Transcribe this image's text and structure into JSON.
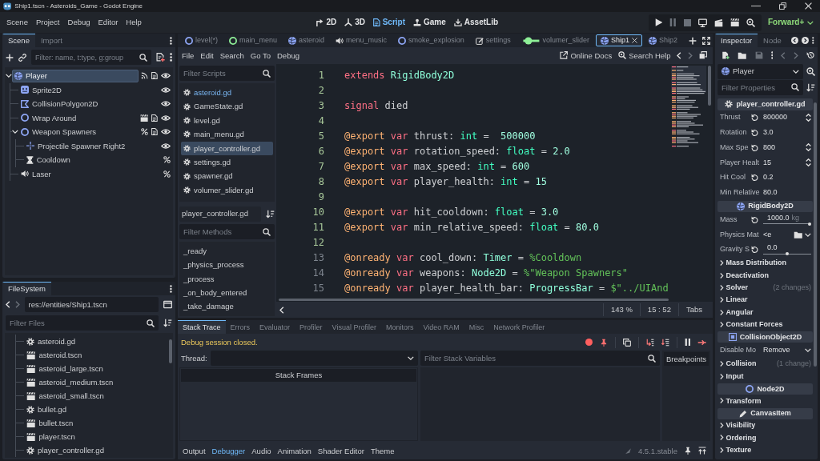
{
  "window": {
    "title": "Ship1.tscn - Asteroids_Game - Godot Engine"
  },
  "menu": [
    "Scene",
    "Project",
    "Debug",
    "Editor",
    "Help"
  ],
  "workspaces": [
    {
      "label": "2D",
      "kind": "canvas",
      "selected": false
    },
    {
      "label": "3D",
      "kind": "spatial",
      "selected": false
    },
    {
      "label": "Script",
      "kind": "script",
      "selected": true
    },
    {
      "label": "Game",
      "kind": "game",
      "selected": false
    },
    {
      "label": "AssetLib",
      "kind": "assetlib",
      "selected": false
    }
  ],
  "renderer": "Forward+",
  "scene_dock": {
    "tabs": [
      {
        "label": "Scene",
        "selected": true
      },
      {
        "label": "Import",
        "selected": false
      }
    ],
    "filter": {
      "placeholder": "Filter: name, t:type, g:group"
    },
    "tree": [
      {
        "name": "Player",
        "kind": "rigidbody",
        "selected": true,
        "expanded": true,
        "badges": [
          {
            "kind": "signal"
          },
          {
            "kind": "script"
          },
          {
            "kind": "eye"
          }
        ],
        "children": [
          {
            "name": "Sprite2D",
            "kind": "sprite",
            "selected": false,
            "badges": [
              {
                "kind": "eye"
              }
            ]
          },
          {
            "name": "CollisionPolygon2D",
            "kind": "polygon",
            "selected": false,
            "badges": [
              {
                "kind": "eye"
              }
            ]
          },
          {
            "name": "Wrap Around",
            "kind": "node2d",
            "selected": false,
            "badges": [
              {
                "kind": "scene"
              },
              {
                "kind": "script"
              },
              {
                "kind": "eye"
              }
            ]
          },
          {
            "name": "Weapon Spawners",
            "kind": "node2d",
            "selected": false,
            "expanded": true,
            "badges": [
              {
                "kind": "unique"
              },
              {
                "kind": "script"
              },
              {
                "kind": "eye"
              }
            ],
            "children": [
              {
                "name": "Projectile Spawner Right2",
                "kind": "marker",
                "selected": false,
                "badges": [
                  {
                    "kind": "eye"
                  }
                ]
              },
              {
                "name": "Cooldown",
                "kind": "timer",
                "selected": false,
                "badges": [
                  {
                    "kind": "unique"
                  }
                ]
              }
            ]
          },
          {
            "name": "Laser",
            "kind": "audio",
            "selected": false,
            "badges": [
              {
                "kind": "unique"
              }
            ]
          }
        ]
      }
    ]
  },
  "filesystem": {
    "tabs": [
      {
        "label": "FileSystem",
        "selected": true
      }
    ],
    "path": "res://entities/Ship1.tscn",
    "filter": {
      "placeholder": "Filter Files"
    },
    "files": [
      {
        "name": "asteroid.gd",
        "kind": "script"
      },
      {
        "name": "asteroid.tscn",
        "kind": "scene"
      },
      {
        "name": "asteroid_large.tscn",
        "kind": "scene"
      },
      {
        "name": "asteroid_medium.tscn",
        "kind": "scene"
      },
      {
        "name": "asteroid_small.tscn",
        "kind": "scene"
      },
      {
        "name": "bullet.gd",
        "kind": "script"
      },
      {
        "name": "bullet.tscn",
        "kind": "scene"
      },
      {
        "name": "player.tscn",
        "kind": "scene"
      },
      {
        "name": "player_controller.gd",
        "kind": "script"
      }
    ]
  },
  "script_tabs": [
    {
      "label": "level(*)",
      "kind": "node2d",
      "selected": false
    },
    {
      "label": "main_menu",
      "kind": "control",
      "selected": false
    },
    {
      "label": "asteroid",
      "kind": "rigidbody",
      "selected": false
    },
    {
      "label": "menu_music",
      "kind": "audio",
      "selected": false
    },
    {
      "label": "smoke_explosion",
      "kind": "node2d",
      "selected": false
    },
    {
      "label": "settings",
      "kind": "edit",
      "selected": false
    },
    {
      "label": "volumer_slider",
      "kind": "slider",
      "selected": false
    },
    {
      "label": "Ship1",
      "kind": "rigidbody",
      "selected": true
    },
    {
      "label": "Ship2",
      "kind": "rigidbody",
      "selected": false
    }
  ],
  "script_menu": [
    "File",
    "Edit",
    "Search",
    "Go To",
    "Debug"
  ],
  "help_links": [
    {
      "label": "Online Docs",
      "kind": "docs"
    },
    {
      "label": "Search Help",
      "kind": "search"
    }
  ],
  "script_list": {
    "filter": {
      "placeholder": "Filter Scripts"
    },
    "items": [
      {
        "name": "asteroid.gd",
        "selected": false,
        "highlighted": true
      },
      {
        "name": "GameState.gd",
        "selected": false,
        "highlighted": false
      },
      {
        "name": "level.gd",
        "selected": false,
        "highlighted": false
      },
      {
        "name": "main_menu.gd",
        "selected": false,
        "highlighted": false
      },
      {
        "name": "player_controller.gd",
        "selected": true,
        "highlighted": false
      },
      {
        "name": "settings.gd",
        "selected": false,
        "highlighted": false
      },
      {
        "name": "spawner.gd",
        "selected": false,
        "highlighted": false
      },
      {
        "name": "volumer_slider.gd",
        "selected": false,
        "highlighted": false
      }
    ],
    "current": "player_controller.gd",
    "method_filter": {
      "placeholder": "Filter Methods"
    },
    "methods": [
      "_ready",
      "_physics_process",
      "_process",
      "_on_body_entered",
      "_take_damage"
    ]
  },
  "code": {
    "lines": [
      {
        "number": "1",
        "safe": true,
        "tokens": [
          {
            "kind": "keyword",
            "text": "extends"
          },
          {
            "kind": "enginetype",
            "text": " RigidBody2D"
          }
        ]
      },
      {
        "number": "2",
        "safe": true
      },
      {
        "number": "3",
        "safe": true,
        "tokens": [
          {
            "kind": "keyword",
            "text": "signal"
          },
          {
            "kind": "plain",
            "text": " died"
          }
        ]
      },
      {
        "number": "4",
        "safe": true
      },
      {
        "number": "5",
        "safe": true,
        "tokens": [
          {
            "kind": "annotation",
            "text": "@export"
          },
          {
            "kind": "keyword",
            "text": " var"
          },
          {
            "kind": "plain",
            "text": " thrust: "
          },
          {
            "kind": "basetype",
            "text": "int"
          },
          {
            "kind": "plain",
            "text": " =  "
          },
          {
            "kind": "number",
            "text": "500000"
          }
        ]
      },
      {
        "number": "6",
        "safe": true,
        "tokens": [
          {
            "kind": "annotation",
            "text": "@export"
          },
          {
            "kind": "keyword",
            "text": " var"
          },
          {
            "kind": "plain",
            "text": " rotation_speed: "
          },
          {
            "kind": "basetype",
            "text": "float"
          },
          {
            "kind": "plain",
            "text": " = "
          },
          {
            "kind": "number",
            "text": "2.0"
          }
        ]
      },
      {
        "number": "7",
        "safe": true,
        "tokens": [
          {
            "kind": "annotation",
            "text": "@export"
          },
          {
            "kind": "keyword",
            "text": " var"
          },
          {
            "kind": "plain",
            "text": " max_speed: "
          },
          {
            "kind": "basetype",
            "text": "int"
          },
          {
            "kind": "plain",
            "text": " = "
          },
          {
            "kind": "number",
            "text": "600"
          }
        ]
      },
      {
        "number": "8",
        "safe": true,
        "tokens": [
          {
            "kind": "annotation",
            "text": "@export"
          },
          {
            "kind": "keyword",
            "text": " var"
          },
          {
            "kind": "plain",
            "text": " player_health: "
          },
          {
            "kind": "basetype",
            "text": "int"
          },
          {
            "kind": "plain",
            "text": " = "
          },
          {
            "kind": "number",
            "text": "15"
          }
        ]
      },
      {
        "number": "9",
        "safe": true
      },
      {
        "number": "10",
        "safe": true,
        "tokens": [
          {
            "kind": "annotation",
            "text": "@export"
          },
          {
            "kind": "keyword",
            "text": " var"
          },
          {
            "kind": "plain",
            "text": " hit_cooldown: "
          },
          {
            "kind": "basetype",
            "text": "float"
          },
          {
            "kind": "plain",
            "text": " = "
          },
          {
            "kind": "number",
            "text": "3.0"
          }
        ]
      },
      {
        "number": "11",
        "safe": true,
        "tokens": [
          {
            "kind": "annotation",
            "text": "@export"
          },
          {
            "kind": "keyword",
            "text": " var"
          },
          {
            "kind": "plain",
            "text": " min_relative_speed: "
          },
          {
            "kind": "basetype",
            "text": "float"
          },
          {
            "kind": "plain",
            "text": " = "
          },
          {
            "kind": "number",
            "text": "80.0"
          }
        ]
      },
      {
        "number": "12",
        "safe": true
      },
      {
        "number": "13",
        "safe": false,
        "tokens": [
          {
            "kind": "annotation",
            "text": "@onready"
          },
          {
            "kind": "keyword",
            "text": " var"
          },
          {
            "kind": "plain",
            "text": " cool_down: "
          },
          {
            "kind": "enginetype",
            "text": "Timer"
          },
          {
            "kind": "plain",
            "text": " = "
          },
          {
            "kind": "nodepath",
            "text": "%Cooldown"
          }
        ]
      },
      {
        "number": "14",
        "safe": false,
        "tokens": [
          {
            "kind": "annotation",
            "text": "@onready"
          },
          {
            "kind": "keyword",
            "text": " var"
          },
          {
            "kind": "plain",
            "text": " weapons: "
          },
          {
            "kind": "enginetype",
            "text": "Node2D"
          },
          {
            "kind": "plain",
            "text": " = "
          },
          {
            "kind": "nodepath",
            "text": "%\"Weapon Spawners\""
          }
        ]
      },
      {
        "number": "15",
        "safe": false,
        "tokens": [
          {
            "kind": "annotation",
            "text": "@onready"
          },
          {
            "kind": "keyword",
            "text": " var"
          },
          {
            "kind": "plain",
            "text": " player_health_bar: "
          },
          {
            "kind": "enginetype",
            "text": "ProgressBar"
          },
          {
            "kind": "plain",
            "text": " = "
          },
          {
            "kind": "nodepath",
            "text": "$\"../UIAnd"
          }
        ]
      }
    ],
    "zoom": "143 %",
    "position": "15 : 52",
    "indent": "Tabs"
  },
  "bottom_panel": {
    "tabs": [
      {
        "label": "Stack Trace",
        "selected": true
      },
      {
        "label": "Errors",
        "selected": false
      },
      {
        "label": "Evaluator",
        "selected": false
      },
      {
        "label": "Profiler",
        "selected": false
      },
      {
        "label": "Visual Profiler",
        "selected": false
      },
      {
        "label": "Monitors",
        "selected": false
      },
      {
        "label": "Video RAM",
        "selected": false
      },
      {
        "label": "Misc",
        "selected": false
      },
      {
        "label": "Network Profiler",
        "selected": false
      }
    ],
    "message": "Debug session closed.",
    "thread_label": "Thread:",
    "variables_filter": {
      "placeholder": "Filter Stack Variables"
    },
    "breakpoints": "Breakpoints",
    "stack_header": "Stack Frames",
    "bottom_tabs": [
      {
        "label": "Output",
        "selected": false
      },
      {
        "label": "Debugger",
        "selected": true
      },
      {
        "label": "Audio",
        "selected": false
      },
      {
        "label": "Animation",
        "selected": false
      },
      {
        "label": "Shader Editor",
        "selected": false
      },
      {
        "label": "Theme",
        "selected": false
      }
    ],
    "version": "4.5.1.stable"
  },
  "inspector": {
    "tabs": [
      {
        "label": "Inspector",
        "selected": true
      },
      {
        "label": "Node",
        "selected": false
      }
    ],
    "object": "Player",
    "filter": {
      "placeholder": "Filter Properties"
    },
    "properties": [
      {
        "kind": "header",
        "label": "player_controller.gd"
      },
      {
        "kind": "number",
        "label": "Thrust",
        "value": "800000",
        "revert": true,
        "spinner": true
      },
      {
        "kind": "number",
        "label": "Rotation",
        "value": "3.0",
        "revert": true,
        "spinner": false
      },
      {
        "kind": "number",
        "label": "Max Spe",
        "value": "800",
        "revert": true,
        "spinner": true
      },
      {
        "kind": "number",
        "label": "Player Healt",
        "value": "15",
        "revert": false,
        "spinner": true
      },
      {
        "kind": "number",
        "label": "Hit Cool",
        "value": "0.2",
        "revert": true,
        "spinner": false
      },
      {
        "kind": "number",
        "label": "Min Relative",
        "value": "80.0",
        "revert": false,
        "spinner": false
      },
      {
        "kind": "header",
        "label": "RigidBody2D"
      },
      {
        "kind": "slider",
        "label": "Mass",
        "value": "1000.0",
        "suffix": "kg",
        "revert": true,
        "level": 1.0
      },
      {
        "kind": "resource",
        "label": "Physics Mat",
        "value": "<e",
        "revert": false
      },
      {
        "kind": "slider",
        "label": "Gravity S",
        "value": "0.0",
        "revert": true,
        "level": 0.5
      },
      {
        "kind": "group",
        "label": "Mass Distribution",
        "expanded": false
      },
      {
        "kind": "group",
        "label": "Deactivation",
        "expanded": false
      },
      {
        "kind": "group",
        "label": "Solver",
        "note": "(2 changes)",
        "expanded": false
      },
      {
        "kind": "group",
        "label": "Linear",
        "expanded": false
      },
      {
        "kind": "group",
        "label": "Angular",
        "expanded": false
      },
      {
        "kind": "group",
        "label": "Constant Forces",
        "expanded": false
      },
      {
        "kind": "header",
        "label": "CollisionObject2D"
      },
      {
        "kind": "enum",
        "label": "Disable Mo",
        "value": "Remove",
        "revert": false
      },
      {
        "kind": "group",
        "label": "Collision",
        "note": "(1 change)",
        "expanded": false
      },
      {
        "kind": "group",
        "label": "Input",
        "expanded": false
      },
      {
        "kind": "header",
        "label": "Node2D"
      },
      {
        "kind": "group",
        "label": "Transform",
        "expanded": false
      },
      {
        "kind": "header",
        "label": "CanvasItem"
      },
      {
        "kind": "group",
        "label": "Visibility",
        "expanded": false
      },
      {
        "kind": "group",
        "label": "Ordering",
        "expanded": false
      },
      {
        "kind": "group",
        "label": "Texture",
        "expanded": false
      }
    ]
  }
}
